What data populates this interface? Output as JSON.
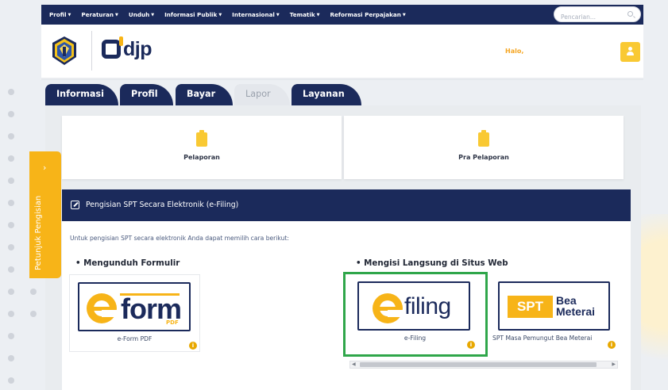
{
  "nav": {
    "items": [
      "Profil",
      "Peraturan",
      "Unduh",
      "Informasi Publik",
      "Internasional",
      "Tematik",
      "Reformasi Perpajakan"
    ],
    "search_placeholder": "Pencarian..."
  },
  "header": {
    "logo_text": "djp",
    "greeting": "Halo,"
  },
  "tabs": [
    "Informasi",
    "Profil",
    "Bayar",
    "Lapor",
    "Layanan"
  ],
  "active_tab": "Lapor",
  "side_tab": "Petunjuk Pengisian",
  "subtabs": {
    "pelaporan": "Pelaporan",
    "pra_pelaporan": "Pra Pelaporan"
  },
  "panel": {
    "title": "Pengisian SPT Secara Elektronik (e-Filing)",
    "intro": "Untuk pengisian SPT secara elektronik Anda dapat memilih cara berikut:",
    "section_download": "• Mengunduh Formulir",
    "section_web": "• Mengisi Langsung di Situs Web"
  },
  "tiles": {
    "eform": {
      "caption": "e-Form PDF",
      "logo_main": "form",
      "logo_sub": "PDF"
    },
    "efiling": {
      "caption": "e-Filing",
      "logo_main": "filing"
    },
    "spt": {
      "caption": "SPT Masa Pemungut Bea Meterai",
      "logo_badge": "SPT",
      "logo_line1": "Bea",
      "logo_line2": "Meterai"
    }
  },
  "colors": {
    "navy": "#1b2a5b",
    "accent": "#f7b418",
    "highlight": "#2fa64a"
  }
}
